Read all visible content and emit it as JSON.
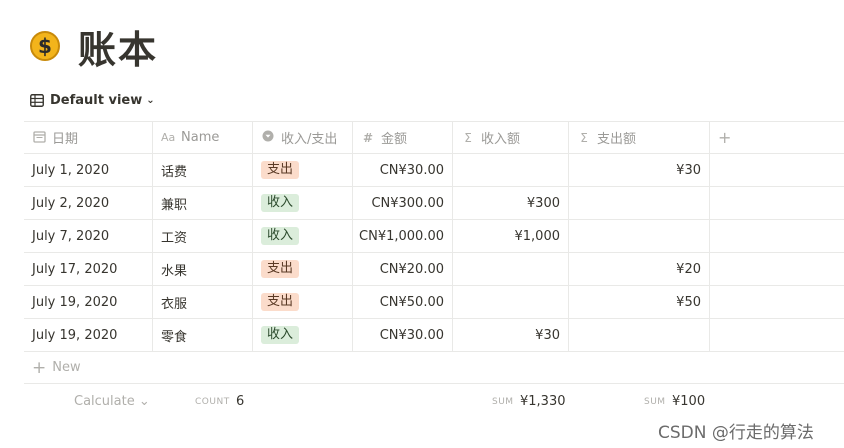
{
  "page": {
    "icon": "dollar-coin-icon",
    "title": "账本"
  },
  "view": {
    "label": "Default view"
  },
  "columns": [
    {
      "label": "日期",
      "icon": "calendar-icon"
    },
    {
      "label": "Name",
      "icon": "text-icon"
    },
    {
      "label": "收入/支出",
      "icon": "select-icon"
    },
    {
      "label": "金额",
      "icon": "number-icon"
    },
    {
      "label": "收入额",
      "icon": "formula-icon"
    },
    {
      "label": "支出额",
      "icon": "formula-icon"
    }
  ],
  "rows": [
    {
      "date": "July 1, 2020",
      "name": "话费",
      "type": "支出",
      "type_kind": "out",
      "amount": "CN¥30.00",
      "income": "",
      "expense": "¥30"
    },
    {
      "date": "July 2, 2020",
      "name": "兼职",
      "type": "收入",
      "type_kind": "in",
      "amount": "CN¥300.00",
      "income": "¥300",
      "expense": ""
    },
    {
      "date": "July 7, 2020",
      "name": "工资",
      "type": "收入",
      "type_kind": "in",
      "amount": "CN¥1,000.00",
      "income": "¥1,000",
      "expense": ""
    },
    {
      "date": "July 17, 2020",
      "name": "水果",
      "type": "支出",
      "type_kind": "out",
      "amount": "CN¥20.00",
      "income": "",
      "expense": "¥20"
    },
    {
      "date": "July 19, 2020",
      "name": "衣服",
      "type": "支出",
      "type_kind": "out",
      "amount": "CN¥50.00",
      "income": "",
      "expense": "¥50"
    },
    {
      "date": "July 19, 2020",
      "name": "零食",
      "type": "收入",
      "type_kind": "in",
      "amount": "CN¥30.00",
      "income": "¥30",
      "expense": ""
    }
  ],
  "new_row": {
    "label": "New"
  },
  "footer": {
    "calculate": "Calculate",
    "count_label": "COUNT",
    "count_value": "6",
    "sum_label": "SUM",
    "income_sum": "¥1,330",
    "expense_sum": "¥100"
  },
  "colors": {
    "tag_out_bg": "#fbdccb",
    "tag_in_bg": "#dbeddb"
  },
  "watermark": "CSDN @行走的算法"
}
